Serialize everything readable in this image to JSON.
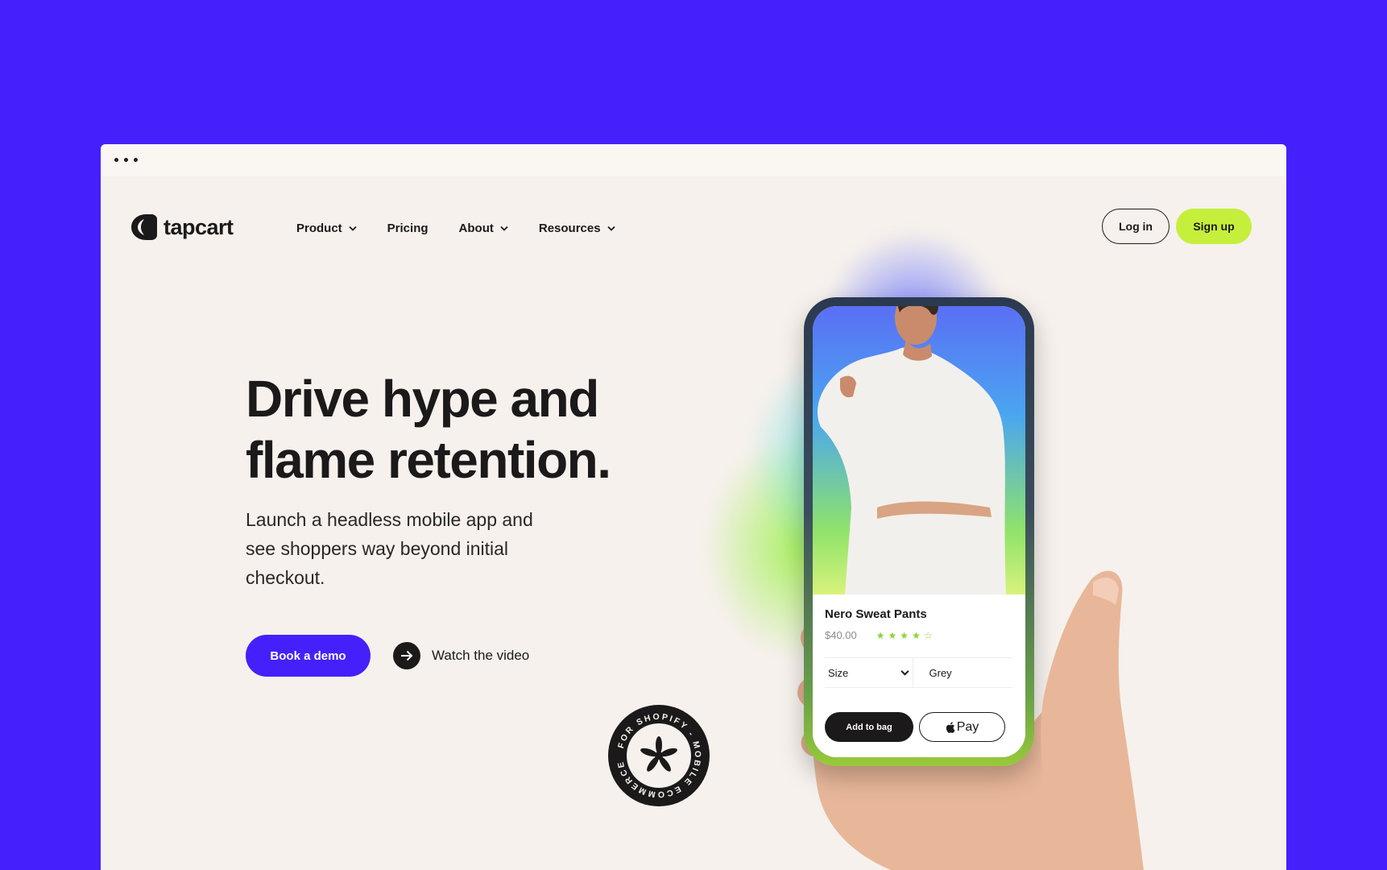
{
  "brand": {
    "name": "tapcart",
    "accent": "#4620fb",
    "lime": "#c6ef3c",
    "dark": "#1b191a",
    "page_bg": "#f6f1ec"
  },
  "nav": {
    "items": [
      {
        "label": "Product",
        "has_dropdown": true
      },
      {
        "label": "Pricing",
        "has_dropdown": false
      },
      {
        "label": "About",
        "has_dropdown": true
      },
      {
        "label": "Resources",
        "has_dropdown": true
      }
    ],
    "login_label": "Log in",
    "signup_label": "Sign up"
  },
  "hero": {
    "title_line1": "Drive hype and",
    "title_line2": "flame retention.",
    "subtitle": "Launch a headless mobile app and see shoppers way beyond initial checkout.",
    "primary_cta": "Book a demo",
    "secondary_cta": "Watch the video"
  },
  "badge": {
    "ring_text": "FOR SHOPIFY - MOBILE ECOMMERCE"
  },
  "phone": {
    "product_name": "Nero Sweat Pants",
    "price": "$40.00",
    "rating": 4.5,
    "rating_max": 5,
    "size_label": "Size",
    "color_value": "Grey",
    "add_to_bag": "Add to bag",
    "pay_label": "Pay"
  },
  "icons": [
    "logo-icon",
    "chevron-down-icon",
    "arrow-right-icon",
    "asterisk-icon",
    "star-icon",
    "apple-icon"
  ]
}
